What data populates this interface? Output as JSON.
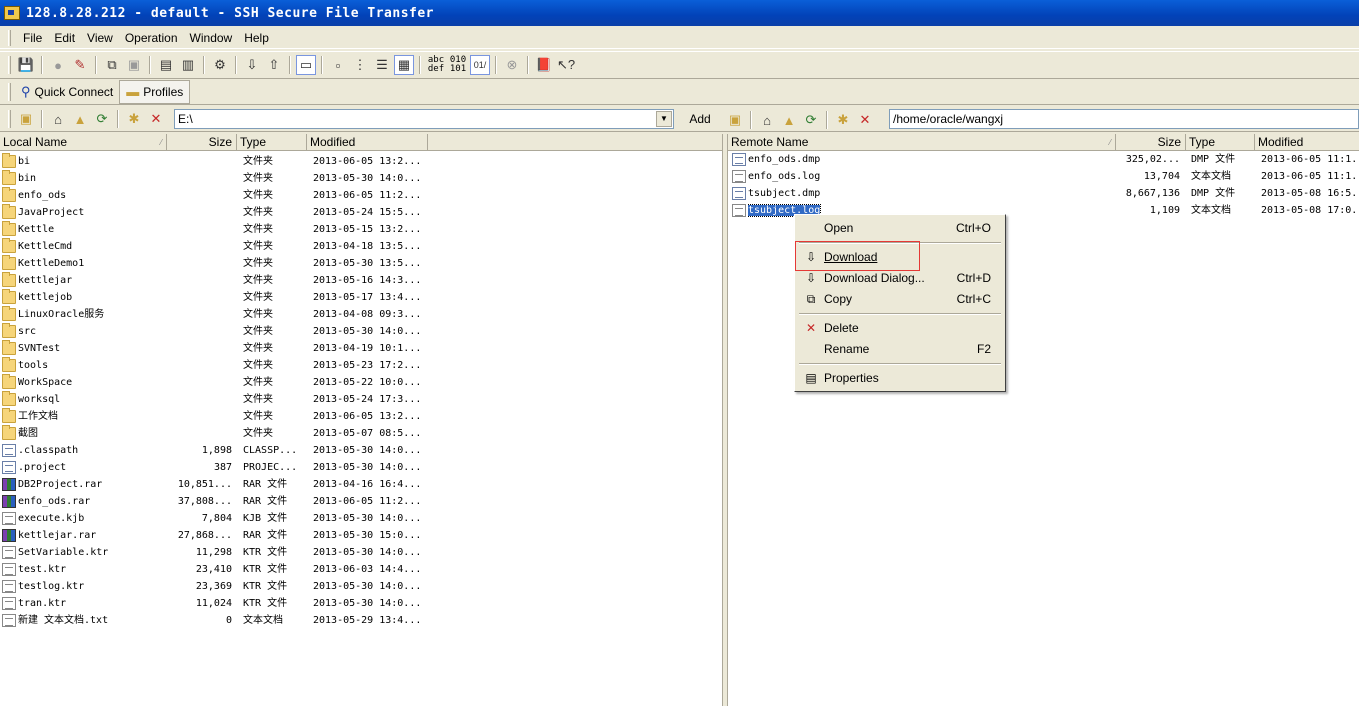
{
  "window": {
    "title": "128.8.28.212 - default - SSH Secure File Transfer"
  },
  "menu": [
    "File",
    "Edit",
    "View",
    "Operation",
    "Window",
    "Help"
  ],
  "toolbar": {
    "quick_connect": "Quick Connect",
    "profiles": "Profiles",
    "text_btn1_top": "abc",
    "text_btn1_bottom": "def",
    "text_btn2_top": "010",
    "text_btn2_bottom": "101"
  },
  "local": {
    "path": "E:\\",
    "add_label": "Add",
    "columns": [
      "Local Name",
      "Size",
      "Type",
      "Modified"
    ],
    "files": [
      {
        "name": "bi",
        "size": "",
        "type": "文件夹",
        "modified": "2013-06-05 13:2...",
        "icon": "folder"
      },
      {
        "name": "bin",
        "size": "",
        "type": "文件夹",
        "modified": "2013-05-30 14:0...",
        "icon": "folder"
      },
      {
        "name": "enfo_ods",
        "size": "",
        "type": "文件夹",
        "modified": "2013-06-05 11:2...",
        "icon": "folder"
      },
      {
        "name": "JavaProject",
        "size": "",
        "type": "文件夹",
        "modified": "2013-05-24 15:5...",
        "icon": "folder"
      },
      {
        "name": "Kettle",
        "size": "",
        "type": "文件夹",
        "modified": "2013-05-15 13:2...",
        "icon": "folder"
      },
      {
        "name": "KettleCmd",
        "size": "",
        "type": "文件夹",
        "modified": "2013-04-18 13:5...",
        "icon": "folder"
      },
      {
        "name": "KettleDemo1",
        "size": "",
        "type": "文件夹",
        "modified": "2013-05-30 13:5...",
        "icon": "folder"
      },
      {
        "name": "kettlejar",
        "size": "",
        "type": "文件夹",
        "modified": "2013-05-16 14:3...",
        "icon": "folder"
      },
      {
        "name": "kettlejob",
        "size": "",
        "type": "文件夹",
        "modified": "2013-05-17 13:4...",
        "icon": "folder"
      },
      {
        "name": "LinuxOracle服务",
        "size": "",
        "type": "文件夹",
        "modified": "2013-04-08 09:3...",
        "icon": "folder"
      },
      {
        "name": "src",
        "size": "",
        "type": "文件夹",
        "modified": "2013-05-30 14:0...",
        "icon": "folder"
      },
      {
        "name": "SVNTest",
        "size": "",
        "type": "文件夹",
        "modified": "2013-04-19 10:1...",
        "icon": "folder"
      },
      {
        "name": "tools",
        "size": "",
        "type": "文件夹",
        "modified": "2013-05-23 17:2...",
        "icon": "folder"
      },
      {
        "name": "WorkSpace",
        "size": "",
        "type": "文件夹",
        "modified": "2013-05-22 10:0...",
        "icon": "folder"
      },
      {
        "name": "worksql",
        "size": "",
        "type": "文件夹",
        "modified": "2013-05-24 17:3...",
        "icon": "folder"
      },
      {
        "name": "工作文档",
        "size": "",
        "type": "文件夹",
        "modified": "2013-06-05 13:2...",
        "icon": "folder"
      },
      {
        "name": "截图",
        "size": "",
        "type": "文件夹",
        "modified": "2013-05-07 08:5...",
        "icon": "folder"
      },
      {
        "name": ".classpath",
        "size": "1,898",
        "type": "CLASSP...",
        "modified": "2013-05-30 14:0...",
        "icon": "doc"
      },
      {
        "name": ".project",
        "size": "387",
        "type": "PROJEC...",
        "modified": "2013-05-30 14:0...",
        "icon": "doc"
      },
      {
        "name": "DB2Project.rar",
        "size": "10,851...",
        "type": "RAR 文件",
        "modified": "2013-04-16 16:4...",
        "icon": "rar"
      },
      {
        "name": "enfo_ods.rar",
        "size": "37,808...",
        "type": "RAR 文件",
        "modified": "2013-06-05 11:2...",
        "icon": "rar"
      },
      {
        "name": "execute.kjb",
        "size": "7,804",
        "type": "KJB 文件",
        "modified": "2013-05-30 14:0...",
        "icon": "txt"
      },
      {
        "name": "kettlejar.rar",
        "size": "27,868...",
        "type": "RAR 文件",
        "modified": "2013-05-30 15:0...",
        "icon": "rar"
      },
      {
        "name": "SetVariable.ktr",
        "size": "11,298",
        "type": "KTR 文件",
        "modified": "2013-05-30 14:0...",
        "icon": "txt"
      },
      {
        "name": "test.ktr",
        "size": "23,410",
        "type": "KTR 文件",
        "modified": "2013-06-03 14:4...",
        "icon": "txt"
      },
      {
        "name": "testlog.ktr",
        "size": "23,369",
        "type": "KTR 文件",
        "modified": "2013-05-30 14:0...",
        "icon": "txt"
      },
      {
        "name": "tran.ktr",
        "size": "11,024",
        "type": "KTR 文件",
        "modified": "2013-05-30 14:0...",
        "icon": "txt"
      },
      {
        "name": "新建 文本文档.txt",
        "size": "0",
        "type": "文本文档",
        "modified": "2013-05-29 13:4...",
        "icon": "txt"
      }
    ]
  },
  "remote": {
    "path": "/home/oracle/wangxj",
    "columns": [
      "Remote Name",
      "Size",
      "Type",
      "Modified"
    ],
    "files": [
      {
        "name": "enfo_ods.dmp",
        "size": "325,02...",
        "type": "DMP 文件",
        "modified": "2013-06-05 11:1.",
        "icon": "doc"
      },
      {
        "name": "enfo_ods.log",
        "size": "13,704",
        "type": "文本文档",
        "modified": "2013-06-05 11:1.",
        "icon": "log"
      },
      {
        "name": "tsubject.dmp",
        "size": "8,667,136",
        "type": "DMP 文件",
        "modified": "2013-05-08 16:5.",
        "icon": "doc"
      },
      {
        "name": "tsubject.log",
        "size": "1,109",
        "type": "文本文档",
        "modified": "2013-05-08 17:0.",
        "icon": "log",
        "selected": true
      }
    ]
  },
  "context_menu": {
    "items": [
      {
        "label": "Open",
        "shortcut": "Ctrl+O",
        "icon": ""
      },
      {
        "label": "Download",
        "shortcut": "",
        "icon": "download-icon"
      },
      {
        "label": "Download Dialog...",
        "shortcut": "Ctrl+D",
        "icon": "download-icon"
      },
      {
        "label": "Copy",
        "shortcut": "Ctrl+C",
        "icon": "copy-icon"
      },
      {
        "label": "Delete",
        "shortcut": "",
        "icon": "delete-icon"
      },
      {
        "label": "Rename",
        "shortcut": "F2",
        "icon": ""
      },
      {
        "label": "Properties",
        "shortcut": "",
        "icon": "properties-icon"
      }
    ]
  },
  "colors": {
    "title_bar": "#0A5FD8",
    "selection": "#316AC5",
    "highlight_box": "#E53935"
  }
}
